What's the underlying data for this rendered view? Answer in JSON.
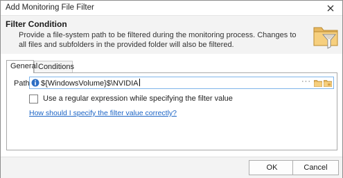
{
  "window": {
    "title": "Add Monitoring File Filter"
  },
  "header": {
    "title": "Filter Condition",
    "description": "Provide a file-system path to be filtered during the monitoring process. Changes to all files and subfolders in the provided folder will also be filtered."
  },
  "tabs": [
    {
      "label": "General",
      "selected": true
    },
    {
      "label": "Conditions",
      "selected": false
    }
  ],
  "general": {
    "path_label": "Path:",
    "path_value": "${WindowsVolume}$\\NVIDIA",
    "ellipsis": "···",
    "regex_label": "Use a regular expression while specifying the filter value",
    "regex_checked": false,
    "help_link": "How should I specify the filter value correctly?"
  },
  "footer": {
    "ok_label": "OK",
    "cancel_label": "Cancel"
  },
  "icons": {
    "close": "close-icon",
    "header": "funnel-folder-icon",
    "info": "info-icon",
    "folder_browse": "folder-icon"
  },
  "colors": {
    "link": "#1a63c5",
    "focus_border": "#7eb4ea",
    "header_bg": "#f3f3f3"
  }
}
